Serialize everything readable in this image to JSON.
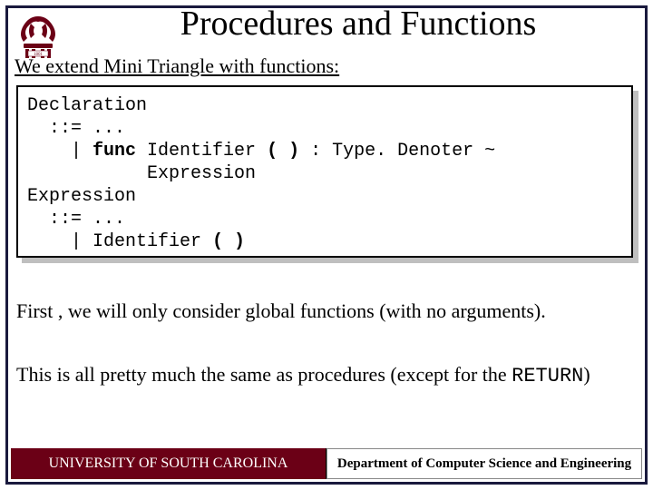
{
  "title": "Procedures and Functions",
  "intro": "We extend Mini Triangle with functions:",
  "code": {
    "l1": "Declaration",
    "l2": "  ::= ...",
    "l3a": "    | ",
    "l3kw": "func",
    "l3b": " Identifier ",
    "l3p1": "( )",
    "l3c": " : ",
    "l3d": "Type. Denoter ~",
    "l4": "           Expression",
    "l5": "Expression",
    "l6": "  ::= ...",
    "l7a": "    | Identifier ",
    "l7p": "( )"
  },
  "para1": "First , we will only consider global functions (with no arguments).",
  "para2a": "This is all pretty much the same as procedures (except for the ",
  "para2mono": "RETURN",
  "para2b": ")",
  "footer_left": "UNIVERSITY OF SOUTH CAROLINA",
  "footer_right": "Department of Computer Science and Engineering"
}
